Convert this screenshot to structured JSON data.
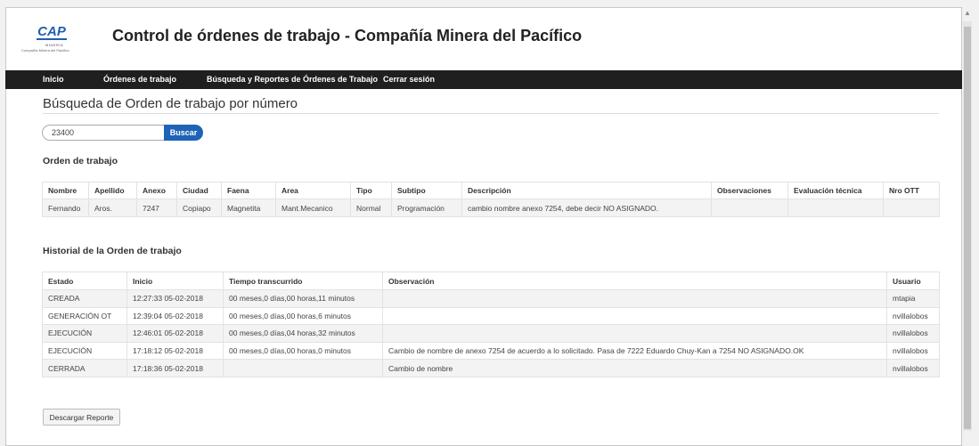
{
  "header": {
    "logo_text": "CAP",
    "logo_sub": "MINERIA",
    "logo_small": "Compañía Minera del Pacífico",
    "title": "Control de órdenes de trabajo - Compañía Minera del Pacífico"
  },
  "nav": {
    "items": [
      "Inicio",
      "Órdenes de trabajo",
      "Búsqueda y Reportes de Órdenes de Trabajo",
      "Cerrar sesión"
    ]
  },
  "search": {
    "section_title": "Búsqueda de Orden de trabajo por número",
    "value": "23400",
    "button_label": "Buscar"
  },
  "orden": {
    "title": "Orden de trabajo",
    "headers": [
      "Nombre",
      "Apellido",
      "Anexo",
      "Ciudad",
      "Faena",
      "Area",
      "Tipo",
      "Subtipo",
      "Descripción",
      "Observaciones",
      "Evaluación técnica",
      "Nro OTT"
    ],
    "row": [
      "Fernando",
      "Aros.",
      "7247",
      "Copiapo",
      "Magnetita",
      "Mant.Mecanico",
      "Normal",
      "Programación",
      "cambio nombre anexo 7254, debe decir NO ASIGNADO.",
      "",
      "",
      ""
    ]
  },
  "historial": {
    "title": "Historial de la Orden de trabajo",
    "headers": [
      "Estado",
      "Inicio",
      "Tiempo transcurrido",
      "Observación",
      "Usuario"
    ],
    "rows": [
      [
        "CREADA",
        "12:27:33 05-02-2018",
        "00 meses,0 días,00 horas,11 minutos",
        "",
        "mtapia"
      ],
      [
        "GENERACIÓN OT",
        "12:39:04 05-02-2018",
        "00 meses,0 días,00 horas,6 minutos",
        "",
        "nvillalobos"
      ],
      [
        "EJECUCIÓN",
        "12:46:01 05-02-2018",
        "00 meses,0 días,04 horas,32 minutos",
        "",
        "nvillalobos"
      ],
      [
        "EJECUCIÓN",
        "17:18:12 05-02-2018",
        "00 meses,0 días,00 horas,0 minutos",
        "Cambio de nombre de anexo 7254 de acuerdo a lo solicitado. Pasa de 7222 Eduardo Chuy-Kan a 7254 NO ASIGNADO.OK",
        "nvillalobos"
      ],
      [
        "CERRADA",
        "17:18:36 05-02-2018",
        "",
        "Cambio de nombre",
        "nvillalobos"
      ]
    ]
  },
  "download": {
    "label": "Descargar Reporte"
  },
  "colors": {
    "navbar": "#1f1f1f",
    "accent": "#1e63b6",
    "logo": "#1f5fae"
  }
}
